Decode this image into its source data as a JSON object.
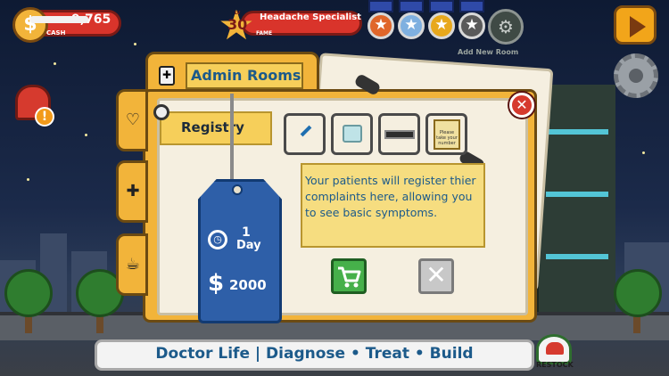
{
  "hud": {
    "cash_value": "9,765",
    "cash_label": "CASH",
    "coin_symbol": "$",
    "level": "30",
    "level_tag": "LV",
    "fame_title": "Headache Specialist",
    "fame_label": "FAME",
    "fame_progress": 0.55,
    "add_room_label": "Add New Room",
    "medal_colors": [
      "#e0662a",
      "#7fb0e0",
      "#e8a81c",
      "#5a5a5a"
    ],
    "mail_alert": "!"
  },
  "dialog": {
    "title": "Admin Rooms",
    "room_name": "Registry",
    "description": "Your patients will register thier complaints here, allowing you to see basic symptoms.",
    "duration_value": "1",
    "duration_unit": "Day",
    "price_currency": "$",
    "price": "2000",
    "tabs": [
      {
        "icon": "stethoscope-icon",
        "glyph": "♡"
      },
      {
        "icon": "medical-doc-icon",
        "glyph": "✚"
      },
      {
        "icon": "coffee-cup-icon",
        "glyph": "☕"
      }
    ],
    "swatches": [
      "pen-icon",
      "device-icon",
      "display-panel-icon",
      "notice-sign-icon"
    ],
    "notice_text": "Please take your number",
    "cancel_glyph": "✕",
    "close_glyph": "✕"
  },
  "banner": {
    "text": "Doctor Life | Diagnose • Treat • Build"
  },
  "restock": {
    "label": "RESTOCK"
  }
}
